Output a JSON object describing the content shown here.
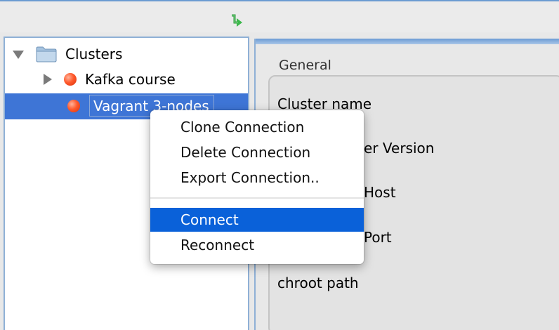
{
  "toolbar": {
    "connect_icon": "green-down-arrow-icon"
  },
  "tree": {
    "root_label": "Clusters",
    "items": [
      {
        "label": "Kafka course",
        "icon": "red-status-dot-icon"
      },
      {
        "label": "Vagrant 3-nodes",
        "icon": "red-status-dot-icon"
      }
    ]
  },
  "context_menu": {
    "items": [
      {
        "label": "Clone Connection"
      },
      {
        "label": "Delete Connection"
      },
      {
        "label": "Export Connection.."
      },
      {
        "label": "Connect"
      },
      {
        "label": "Reconnect"
      }
    ]
  },
  "detail": {
    "group_title": "General",
    "fields": [
      {
        "label": "Cluster name"
      },
      {
        "label": "er Version"
      },
      {
        "label": "Host"
      },
      {
        "label": "Port"
      },
      {
        "label": "chroot path"
      }
    ]
  },
  "colors": {
    "selection_blue": "#3e75d6",
    "menu_highlight": "#0a61d9",
    "status_red": "#ff5a2c"
  }
}
